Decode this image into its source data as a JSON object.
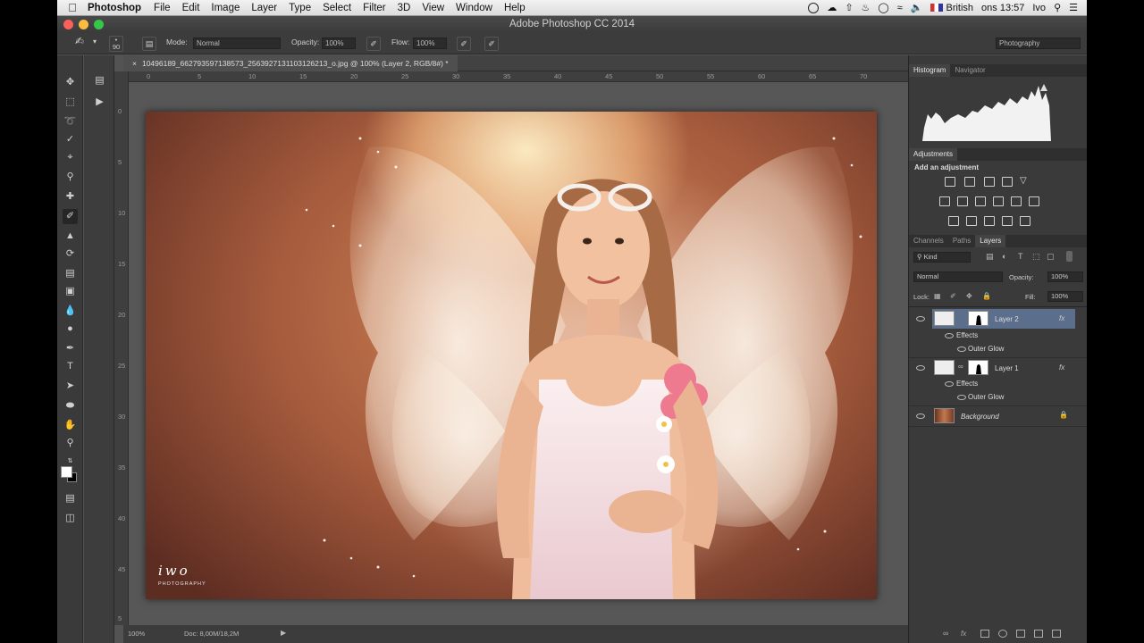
{
  "menubar": {
    "app_name": "Photoshop",
    "items": [
      "File",
      "Edit",
      "Image",
      "Layer",
      "Type",
      "Select",
      "Filter",
      "3D",
      "View",
      "Window",
      "Help"
    ],
    "input_source": "British",
    "clock": "ons 13:57",
    "user": "Ivo"
  },
  "window": {
    "title": "Adobe Photoshop CC 2014"
  },
  "options": {
    "brush_size": "90",
    "mode_label": "Mode:",
    "mode_value": "Normal",
    "opacity_label": "Opacity:",
    "opacity_value": "100%",
    "flow_label": "Flow:",
    "flow_value": "100%",
    "workspace": "Photography"
  },
  "document": {
    "tab_title": "10496189_662793597138573_2563927131103126213_o.jpg @ 100% (Layer 2, RGB/8#) *",
    "ruler_top": [
      "0",
      "5",
      "10",
      "15",
      "20",
      "25",
      "30",
      "35",
      "40",
      "45",
      "50",
      "55",
      "60",
      "65",
      "70"
    ],
    "ruler_left": [
      "0",
      "5",
      "10",
      "15",
      "20",
      "25",
      "30",
      "35",
      "40",
      "45",
      "5"
    ],
    "watermark_main": "iwo",
    "watermark_sub": "PHOTOGRAPHY",
    "zoom": "100%",
    "doc_size": "Doc: 8,00M/18,2M"
  },
  "panels": {
    "tabs_top": [
      "Histogram",
      "Navigator"
    ],
    "adjustments_title": "Adjustments",
    "add_adjustment": "Add an adjustment",
    "tabs_layers": [
      "Channels",
      "Paths",
      "Layers"
    ],
    "kind_label": "Kind",
    "blend_mode": "Normal",
    "opacity_label": "Opacity:",
    "opacity_value": "100%",
    "lock_label": "Lock:",
    "fill_label": "Fill:",
    "fill_value": "100%",
    "layers": [
      {
        "name": "Layer 2",
        "effects": "Effects",
        "effect_item": "Outer Glow"
      },
      {
        "name": "Layer 1",
        "effects": "Effects",
        "effect_item": "Outer Glow"
      },
      {
        "name": "Background"
      }
    ]
  },
  "colors": {
    "accent_selected_layer": "#5b6e8c",
    "panel_bg": "#3a3a3a",
    "canvas_bg": "#575757"
  }
}
